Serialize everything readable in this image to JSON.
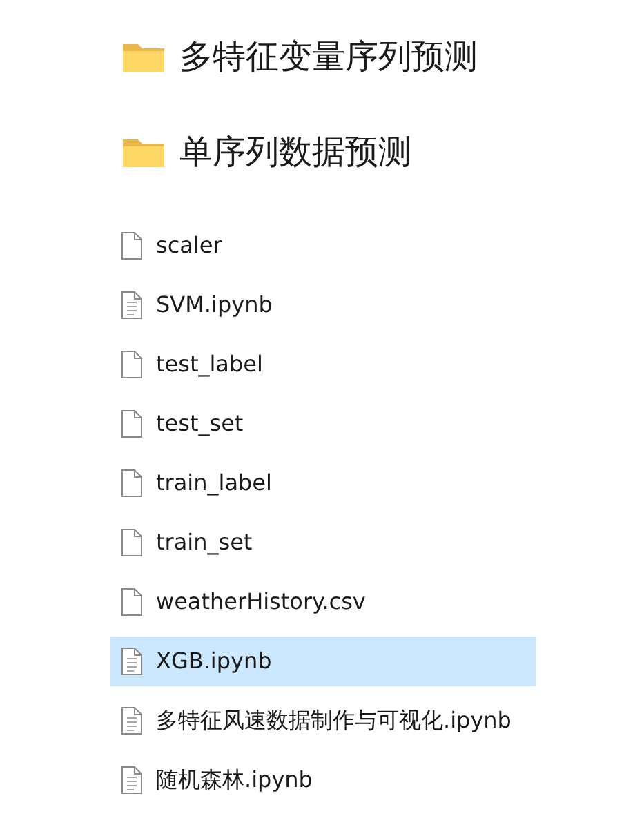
{
  "folders": [
    {
      "name": "多特征变量序列预测"
    },
    {
      "name": "单序列数据预测"
    }
  ],
  "files": [
    {
      "name": "scaler",
      "kind": "blank",
      "selected": false
    },
    {
      "name": "SVM.ipynb",
      "kind": "text",
      "selected": false
    },
    {
      "name": "test_label",
      "kind": "blank",
      "selected": false
    },
    {
      "name": "test_set",
      "kind": "blank",
      "selected": false
    },
    {
      "name": "train_label",
      "kind": "blank",
      "selected": false
    },
    {
      "name": "train_set",
      "kind": "blank",
      "selected": false
    },
    {
      "name": "weatherHistory.csv",
      "kind": "blank",
      "selected": false
    },
    {
      "name": "XGB.ipynb",
      "kind": "text",
      "selected": true
    },
    {
      "name": "多特征风速数据制作与可视化.ipynb",
      "kind": "text",
      "selected": false
    },
    {
      "name": "随机森林.ipynb",
      "kind": "text",
      "selected": false
    }
  ]
}
